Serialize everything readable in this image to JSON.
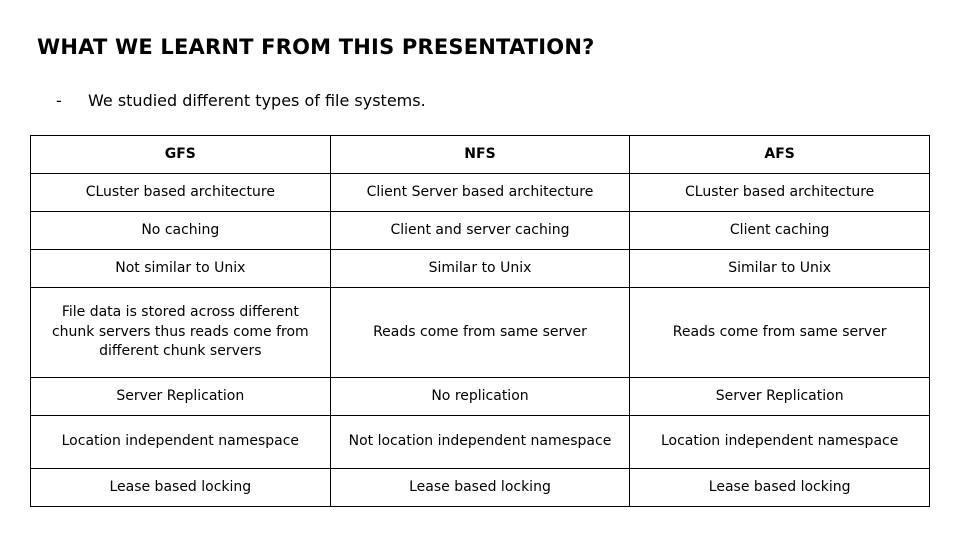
{
  "slide": {
    "title": "WHAT WE LEARNT FROM THIS PRESENTATION?",
    "bullets": [
      {
        "marker": "-",
        "text": "We studied different types of file systems."
      }
    ]
  },
  "table": {
    "headers": [
      "GFS",
      "NFS",
      "AFS"
    ],
    "rows": [
      [
        "CLuster based architecture",
        "Client Server based architecture",
        "CLuster based architecture"
      ],
      [
        "No caching",
        "Client and server caching",
        "Client caching"
      ],
      [
        "Not similar to Unix",
        "Similar to Unix",
        "Similar to Unix"
      ],
      [
        "File data is stored across different chunk servers thus reads come from different chunk servers",
        "Reads come from same server",
        "Reads come from same server"
      ],
      [
        "Server Replication",
        "No replication",
        "Server Replication"
      ],
      [
        "Location independent namespace",
        "Not location independent namespace",
        "Location independent namespace"
      ],
      [
        "Lease based locking",
        "Lease based locking",
        "Lease based locking"
      ]
    ]
  }
}
